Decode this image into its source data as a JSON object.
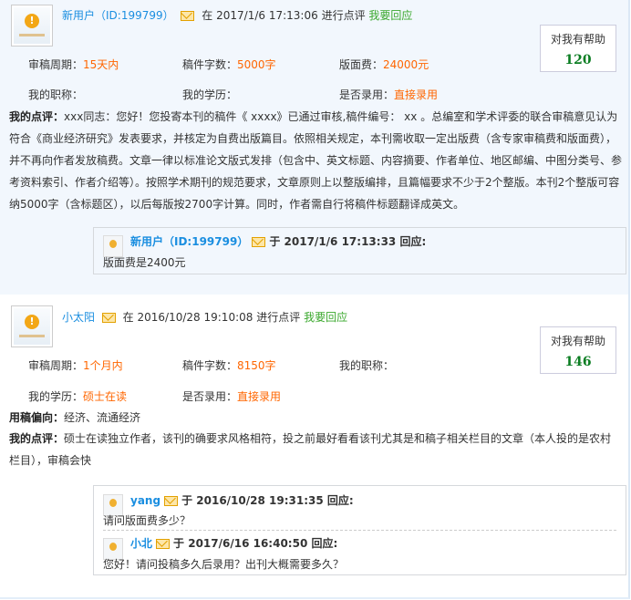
{
  "entries": [
    {
      "user": "新用户（ID:199799）",
      "at": "在",
      "time": "2017/1/6 17:13:06",
      "action": "进行点评",
      "respond": "我要回应",
      "help_label": "对我有帮助",
      "help_count": "120",
      "fields": [
        {
          "label": "审稿周期：",
          "value": "15天内"
        },
        {
          "label": "稿件字数：",
          "value": "5000字"
        },
        {
          "label": "版面费：",
          "value": "24000元"
        },
        {
          "label": "我的职称：",
          "value": ""
        },
        {
          "label": "我的学历：",
          "value": ""
        },
        {
          "label": "是否录用：",
          "value": "直接录用"
        }
      ],
      "review_label": "我的点评：",
      "review": "xxx同志：您好！您投寄本刊的稿件《 xxxx》已通过审核,稿件编号： xx 。总编室和学术评委的联合审稿意见认为符合《商业经济研究》发表要求，并核定为自费出版篇目。依照相关规定，本刊需收取一定出版费（含专家审稿费和版面费），并不再向作者发放稿费。文章一律以标准论文版式发排（包含中、英文标题、内容摘要、作者单位、地区邮编、中图分类号、参考资料索引、作者介绍等）。按照学术期刊的规范要求，文章原则上以整版编排，且篇幅要求不少于2个整版。本刊2个整版可容纳5000字（含标题区），以后每版按2700字计算。同时，作者需自行将稿件标题翻译成英文。",
      "replies": [
        {
          "user": "新用户（ID:199799）",
          "at": "于",
          "time": "2017/1/6  17:13:33",
          "suffix": "回应:",
          "text": "版面费是2400元"
        }
      ]
    },
    {
      "user": "小太阳",
      "at": "在",
      "time": "2016/10/28 19:10:08",
      "action": "进行点评",
      "respond": "我要回应",
      "help_label": "对我有帮助",
      "help_count": "146",
      "fields": [
        {
          "label": "审稿周期：",
          "value": "1个月内"
        },
        {
          "label": "稿件字数：",
          "value": "8150字"
        },
        {
          "label": "我的职称：",
          "value": ""
        },
        {
          "label": "我的学历：",
          "value": "硕士在读"
        },
        {
          "label": "是否录用：",
          "value": "直接录用"
        }
      ],
      "direction_label": "用稿偏向：",
      "direction": "经济、流通经济",
      "review_label": "我的点评：",
      "review": "硕士在读独立作者，该刊的确要求风格相符，投之前最好看看该刊尤其是和稿子相关栏目的文章（本人投的是农村栏目），审稿会快",
      "replies": [
        {
          "user": "yang",
          "at": "于",
          "time": "2016/10/28  19:31:35",
          "suffix": "回应:",
          "text": "请问版面费多少？"
        },
        {
          "user": "小北",
          "at": "于",
          "time": "2017/6/16  16:40:50",
          "suffix": "回应:",
          "text": "您好！请问投稿多久后录用？出刊大概需要多久？"
        }
      ]
    }
  ]
}
